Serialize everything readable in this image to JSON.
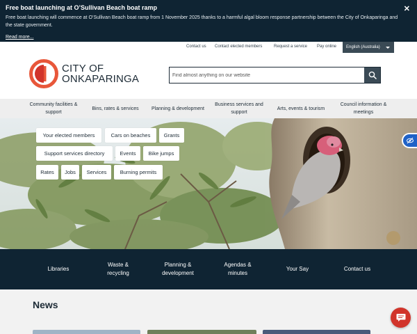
{
  "alert": {
    "title": "Free boat launching at O’Sullivan Beach boat ramp",
    "text": "Free boat launching will commence at O’Sullivan Beach boat ramp from 1 November 2025 thanks to a harmful algal bloom response partnership between the City of Onkaparinga and the state government.",
    "link": "Read more...",
    "close": "✕"
  },
  "utility": {
    "links": [
      "Contact us",
      "Contact elected members",
      "Request a service",
      "Pay online"
    ],
    "language": "English (Australia)"
  },
  "logo": {
    "line1": "CITY OF",
    "line2": "ONKAPARINGA"
  },
  "search": {
    "placeholder": "Find almost anything on our website"
  },
  "mainnav": {
    "items": [
      "Community facilities & support",
      "Bins, rates & services",
      "Planning & development",
      "Business services and support",
      "Arts, events & tourism",
      "Council information & meetings"
    ]
  },
  "hero": {
    "chips": [
      "Your elected members",
      "Cars on beaches",
      "Grants",
      "Support services directory",
      "Events",
      "Bike jumps",
      "Rates",
      "Jobs",
      "Services",
      "Burning permits"
    ]
  },
  "quick": {
    "links": [
      "Libraries",
      "Waste & recycling",
      "Planning & development",
      "Agendas & minutes",
      "Your Say",
      "Contact us"
    ]
  },
  "news": {
    "title": "News"
  },
  "colors": {
    "navy": "#0f2433",
    "accent_red": "#d1342b",
    "accent_orange": "#e8573a",
    "access_blue": "#1f62c7"
  }
}
